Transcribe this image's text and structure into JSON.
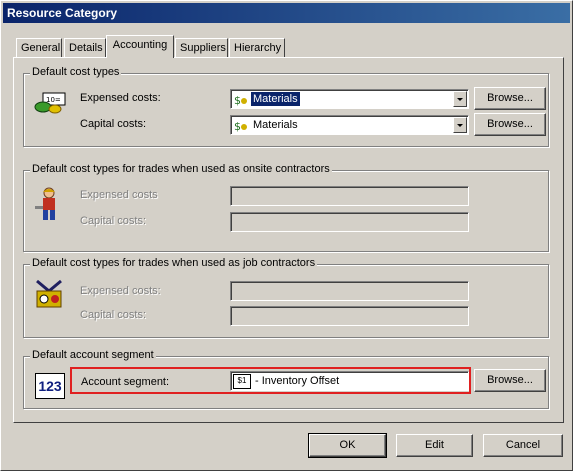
{
  "window": {
    "title": "Resource Category"
  },
  "tabs": [
    {
      "label": "General"
    },
    {
      "label": "Details"
    },
    {
      "label": "Accounting"
    },
    {
      "label": "Suppliers"
    },
    {
      "label": "Hierarchy"
    }
  ],
  "cost_types": {
    "title": "Default cost types",
    "expensed_label": "Expensed costs:",
    "expensed_value": "Materials",
    "capital_label": "Capital costs:",
    "capital_value": "Materials",
    "browse": "Browse..."
  },
  "onsite": {
    "title": "Default cost types for trades when used as onsite contractors",
    "expensed_label": "Expensed costs",
    "capital_label": "Capital costs:"
  },
  "job": {
    "title": "Default cost types for trades when used as job contractors",
    "expensed_label": "Expensed costs:",
    "capital_label": "Capital costs:"
  },
  "account": {
    "title": "Default account segment",
    "label": "Account segment:",
    "value": "- Inventory Offset",
    "icon_text": "123",
    "browse": "Browse...",
    "field_icon_text": "$1"
  },
  "buttons": {
    "ok": "OK",
    "edit": "Edit",
    "cancel": "Cancel"
  },
  "colors": {
    "title_bar": "#0a246a",
    "highlight": "#e02020",
    "selection": "#0a246a"
  }
}
